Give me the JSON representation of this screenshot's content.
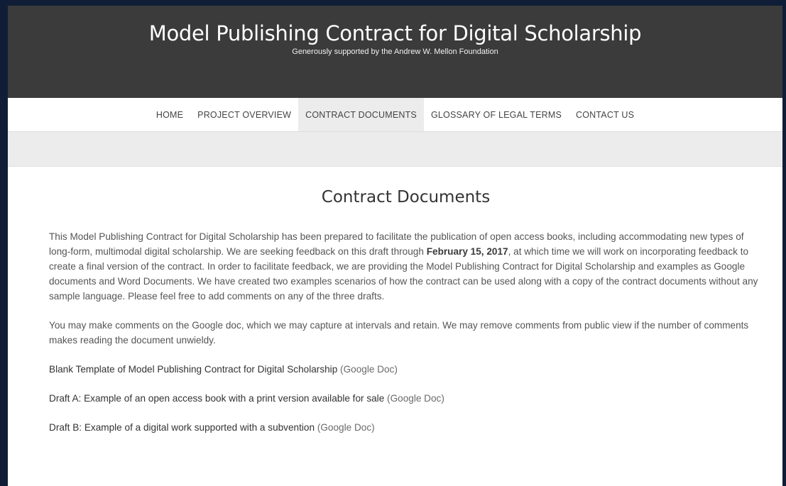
{
  "header": {
    "title": "Model Publishing Contract for Digital Scholarship",
    "tagline": "Generously supported by the Andrew W. Mellon Foundation"
  },
  "nav": {
    "items": [
      {
        "label": "HOME"
      },
      {
        "label": "PROJECT OVERVIEW"
      },
      {
        "label": "CONTRACT DOCUMENTS",
        "active": true
      },
      {
        "label": "GLOSSARY OF LEGAL TERMS"
      },
      {
        "label": "CONTACT US"
      }
    ]
  },
  "page": {
    "title": "Contract Documents",
    "intro": {
      "before": "This Model Publishing Contract for Digital Scholarship has been prepared to facilitate the publication of open access books, including accommodating new types of long-form, multimodal digital scholarship. We are seeking feedback on this draft through ",
      "date": "February 15, 2017",
      "after": ", at which time we will work on incorporating feedback to create a final version of the contract. In order to facilitate feedback, we are providing the Model Publishing Contract for Digital Scholarship and examples as Google documents and Word Documents. We have created two examples scenarios of how the contract can be used along with a copy of the contract documents without any sample language. Please feel free to add comments on any of the three drafts."
    },
    "comments_note": "You may make comments on the Google doc, which we may capture at intervals and retain. We may remove comments from public view if the number of comments makes reading the document unwieldy.",
    "documents": [
      {
        "label": "Blank Template of Model Publishing Contract for Digital Scholarship",
        "type": "(Google Doc)"
      },
      {
        "label": "Draft A: Example of an open access book with a print version available for sale",
        "type": "(Google Doc)"
      },
      {
        "label": "Draft B: Example of a digital work supported with a subvention",
        "type": "(Google Doc)"
      }
    ]
  }
}
